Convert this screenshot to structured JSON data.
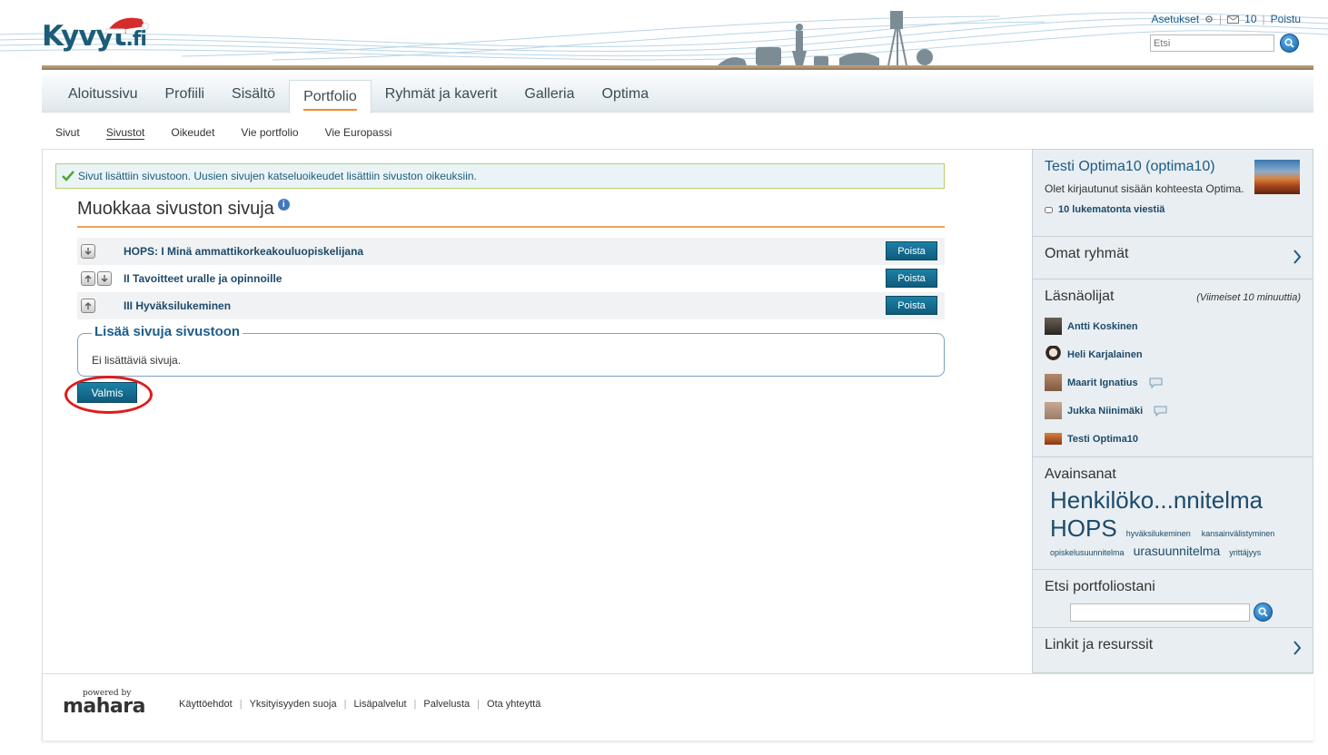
{
  "header": {
    "logo": "Kyvyt",
    "logo_suffix": ".fi",
    "settings": "Asetukset",
    "inbox_count": "10",
    "logout": "Poistu",
    "search_placeholder": "Etsi"
  },
  "mainnav": [
    "Aloitussivu",
    "Profiili",
    "Sisältö",
    "Portfolio",
    "Ryhmät ja kaverit",
    "Galleria",
    "Optima"
  ],
  "subnav": [
    "Sivut",
    "Sivustot",
    "Oikeudet",
    "Vie portfolio",
    "Vie Europassi"
  ],
  "message": "Sivut lisättiin sivustoon. Uusien sivujen katseluoikeudet lisättiin sivuston oikeuksiin.",
  "page_title": "Muokkaa sivuston sivuja",
  "pages": [
    {
      "title": "HOPS: I Minä ammattikorkeakouluopiskelijana",
      "button": "Poista"
    },
    {
      "title": "II Tavoitteet uralle ja opinnoille",
      "button": "Poista"
    },
    {
      "title": "III Hyväksilukeminen",
      "button": "Poista"
    }
  ],
  "add_section": {
    "legend": "Lisää sivuja sivustoon",
    "text": "Ei lisättäviä sivuja."
  },
  "done_button": "Valmis",
  "sidebar": {
    "user": {
      "name": "Testi Optima10 (optima10)",
      "sub": "Olet kirjautunut sisään kohteesta Optima.",
      "unread": "10 lukematonta viestiä"
    },
    "groups": "Omat ryhmät",
    "online": {
      "title": "Läsnäolijat",
      "note": "(Viimeiset 10 minuuttia)",
      "users": [
        "Antti Koskinen",
        "Heli Karjalainen",
        "Maarit Ignatius",
        "Jukka Niinimäki",
        "Testi Optima10"
      ]
    },
    "tags": {
      "title": "Avainsanat",
      "t1": "Henkilöko...nnitelma",
      "t2": "HOPS",
      "t3": "hyväksilukeminen",
      "t4": "kansainvälistyminen",
      "t5": "opiskelusuunnitelma",
      "t6": "urasuunnitelma",
      "t7": "yrittäjyys"
    },
    "search_title": "Etsi portfoliostani",
    "links": "Linkit ja resurssit"
  },
  "footer": {
    "powered": "powered by",
    "brand": "mahara",
    "links": [
      "Käyttöehdot",
      "Yksityisyyden suoja",
      "Lisäpalvelut",
      "Palvelusta",
      "Ota yhteyttä"
    ]
  }
}
